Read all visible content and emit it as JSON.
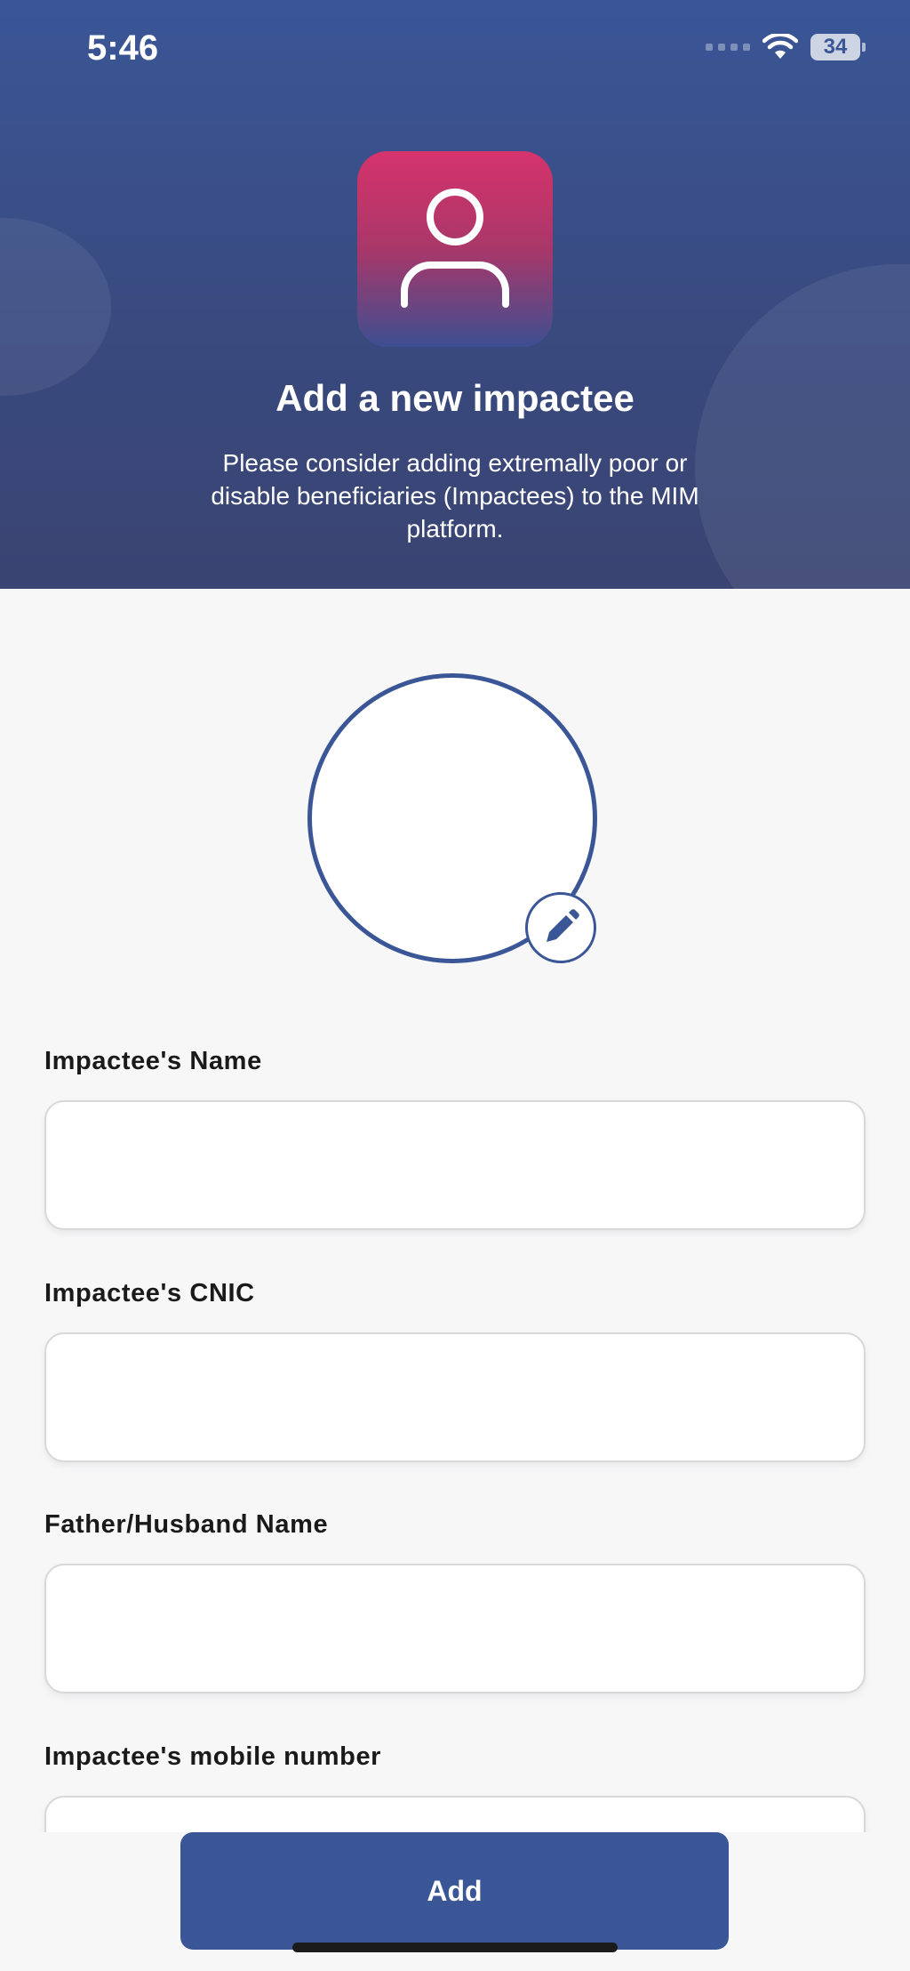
{
  "status_bar": {
    "time": "5:46",
    "battery": "34"
  },
  "header": {
    "icon": "person-icon",
    "title": "Add a new impactee",
    "subtitle": "Please consider adding extremally poor or disable beneficiaries (Impactees) to the MIM platform."
  },
  "photo": {
    "edit_icon": "pencil-icon"
  },
  "form": {
    "fields": [
      {
        "label": "Impactee's Name",
        "value": ""
      },
      {
        "label": "Impactee's CNIC",
        "value": ""
      },
      {
        "label": "Father/Husband Name",
        "value": ""
      },
      {
        "label": "Impactee's mobile number",
        "value": ""
      }
    ]
  },
  "actions": {
    "add_label": "Add"
  },
  "colors": {
    "primary": "#3a5697",
    "icon_gradient_top": "#d6336c",
    "background": "#f7f7f8"
  }
}
